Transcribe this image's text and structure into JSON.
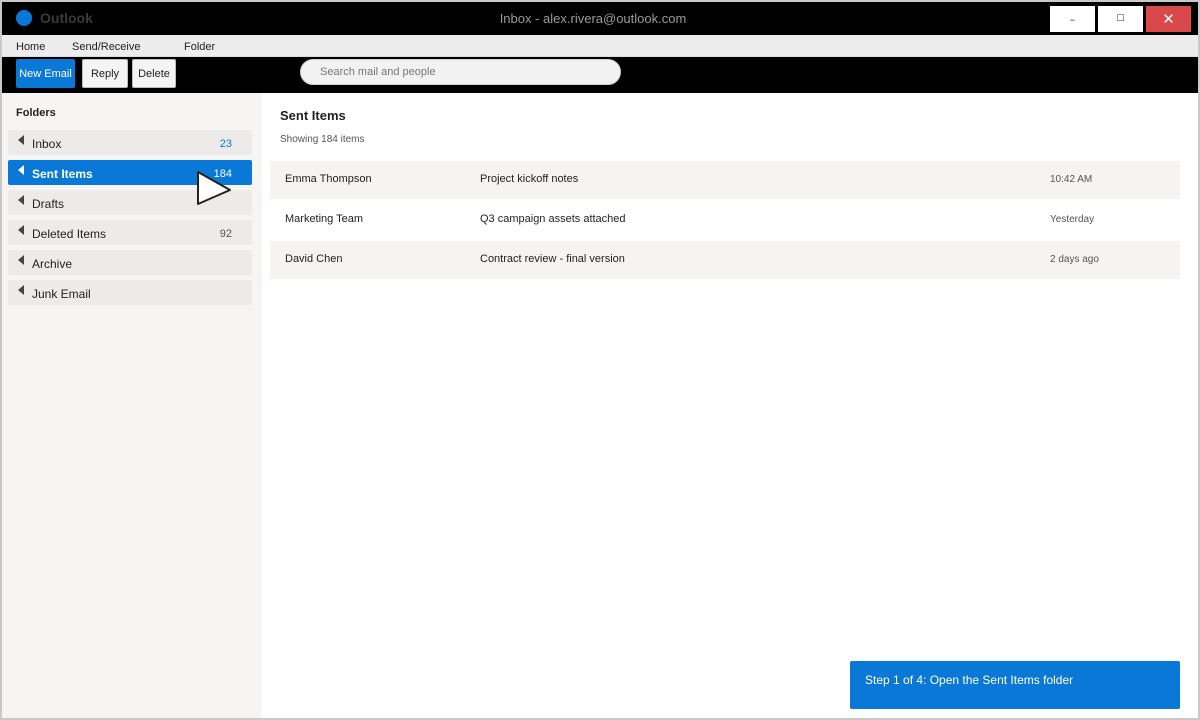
{
  "app": {
    "name": "Outlook",
    "window_title": "Inbox - alex.rivera@outlook.com",
    "accent_color": "#0a78d7"
  },
  "window_controls": {
    "minimize": "–",
    "maximize": "☐",
    "close": "✕"
  },
  "menu": {
    "items": [
      "Home",
      "Send/Receive",
      "Folder"
    ]
  },
  "toolbar": {
    "new_email": "New Email",
    "reply": "Reply",
    "delete": "Delete",
    "search_placeholder": "Search mail and people"
  },
  "sidebar": {
    "heading": "Folders",
    "folders": [
      {
        "label": "Inbox",
        "count": "23",
        "icon": "chevron-left-icon"
      },
      {
        "label": "Sent Items",
        "count": "184",
        "icon": "chevron-left-icon",
        "selected": true
      },
      {
        "label": "Drafts",
        "count": "",
        "icon": "chevron-left-icon"
      },
      {
        "label": "Deleted Items",
        "count": "92",
        "icon": "chevron-left-icon"
      },
      {
        "label": "Archive",
        "count": "",
        "icon": "chevron-left-icon"
      },
      {
        "label": "Junk Email",
        "count": "",
        "icon": "chevron-left-icon"
      }
    ]
  },
  "main": {
    "title": "Sent Items",
    "subtitle": "Showing 184 items",
    "messages": [
      {
        "from": "Emma Thompson",
        "subject": "Project kickoff notes",
        "time": "10:42 AM"
      },
      {
        "from": "Marketing Team",
        "subject": "Q3 campaign assets attached",
        "time": "Yesterday"
      },
      {
        "from": "David Chen",
        "subject": "Contract review - final version",
        "time": "2 days ago"
      }
    ]
  },
  "step_banner": {
    "text": "Step 1 of 4: Open the Sent Items folder"
  },
  "cursor": {
    "icon": "mouse-pointer-icon"
  }
}
